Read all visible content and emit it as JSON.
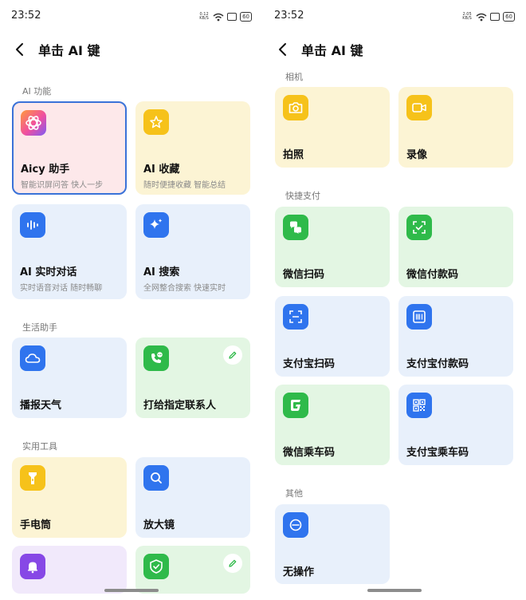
{
  "left": {
    "time": "23:52",
    "net_speed": "0.12 KB/S",
    "battery": "60",
    "title": "单击 AI 键",
    "sections": {
      "ai": "AI 功能",
      "life": "生活助手",
      "tools": "实用工具"
    },
    "tiles": {
      "aicy": {
        "title": "Aicy 助手",
        "subtitle": "智能识屏问答 快人一步",
        "icon": "aicy-logo-icon"
      },
      "collect": {
        "title": "AI 收藏",
        "subtitle": "随时便捷收藏 智能总结",
        "icon": "star-icon"
      },
      "chat": {
        "title": "AI 实时对话",
        "subtitle": "实时语音对话 随时畅聊",
        "icon": "voice-wave-icon"
      },
      "search": {
        "title": "AI 搜索",
        "subtitle": "全网整合搜索 快速实时",
        "icon": "sparkle-icon"
      },
      "weather": {
        "title": "播报天气",
        "icon": "cloud-icon"
      },
      "call": {
        "title": "打给指定联系人",
        "icon": "phone-chat-icon"
      },
      "flashlight": {
        "title": "手电筒",
        "icon": "flashlight-icon"
      },
      "magnifier": {
        "title": "放大镜",
        "icon": "magnifier-icon"
      },
      "bell": {
        "icon": "bell-icon"
      },
      "shield": {
        "icon": "shield-icon"
      }
    }
  },
  "right": {
    "time": "23:52",
    "net_speed": "2.05 KB/S",
    "battery": "60",
    "title": "单击 AI 键",
    "sections": {
      "camera": "相机",
      "pay": "快捷支付",
      "other": "其他"
    },
    "tiles": {
      "photo": {
        "title": "拍照",
        "icon": "camera-icon"
      },
      "video": {
        "title": "录像",
        "icon": "video-icon"
      },
      "wechat_scan": {
        "title": "微信扫码",
        "icon": "wechat-scan-icon"
      },
      "wechat_pay": {
        "title": "微信付款码",
        "icon": "wechat-pay-icon"
      },
      "alipay_scan": {
        "title": "支付宝扫码",
        "icon": "scan-icon"
      },
      "alipay_pay": {
        "title": "支付宝付款码",
        "icon": "barcode-icon"
      },
      "wechat_bus": {
        "title": "微信乘车码",
        "icon": "wechat-bus-icon"
      },
      "alipay_bus": {
        "title": "支付宝乘车码",
        "icon": "qrcode-icon"
      },
      "none": {
        "title": "无操作",
        "icon": "no-action-icon"
      }
    }
  }
}
